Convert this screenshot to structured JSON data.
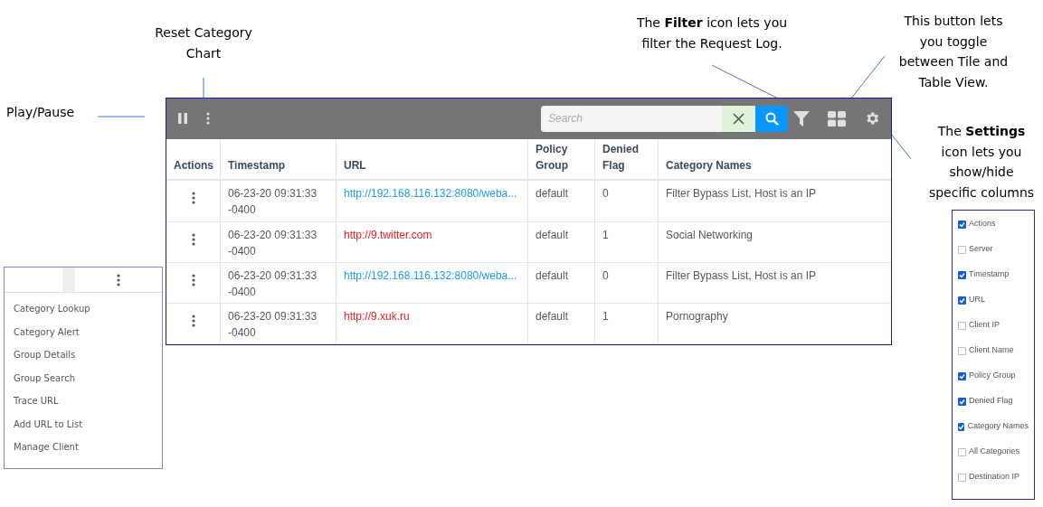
{
  "annotations": {
    "reset": "Reset Category Chart",
    "play_pause": "Play/Pause",
    "filter": "The **Filter** icon lets you filter the Request Log.",
    "toggle": "This button lets you toggle between Tile and Table View.",
    "settings": "The **Settings** icon lets you show/hide specific columns"
  },
  "toolbar": {
    "search_placeholder": "Search"
  },
  "table": {
    "columns": [
      "Actions",
      "Timestamp",
      "URL",
      "Policy Group",
      "Denied Flag",
      "Category Names"
    ],
    "rows": [
      {
        "timestamp": "06-23-20 09:31:33 -0400",
        "url": "http://192.168.116.132:8080/weba...",
        "color": "#1a9af0",
        "policy_group": "default",
        "denied_flag": "0",
        "category_names": "Filter Bypass List, Host is an IP"
      },
      {
        "timestamp": "06-23-20 09:31:33 -0400",
        "url": "http://9.twitter.com",
        "color": "#f02020",
        "policy_group": "default",
        "denied_flag": "1",
        "category_names": "Social Networking"
      },
      {
        "timestamp": "06-23-20 09:31:33 -0400",
        "url": "http://192.168.116.132:8080/weba...",
        "color": "#1a9af0",
        "policy_group": "default",
        "denied_flag": "0",
        "category_names": "Filter Bypass List, Host is an IP"
      },
      {
        "timestamp": "06-23-20 09:31:33 -0400",
        "url": "http://9.xuk.ru",
        "color": "#f02020",
        "policy_group": "default",
        "denied_flag": "1",
        "category_names": "Pornography"
      }
    ]
  },
  "actions_menu": [
    "Category Lookup",
    "Category Alert",
    "Group Details",
    "Group Search",
    "Trace URL",
    "Add URL to List",
    "Manage Client"
  ],
  "columns_panel": [
    {
      "label": "Actions",
      "checked": true
    },
    {
      "label": "Server",
      "checked": false
    },
    {
      "label": "Timestamp",
      "checked": true
    },
    {
      "label": "URL",
      "checked": true
    },
    {
      "label": "Client IP",
      "checked": false
    },
    {
      "label": "Client Name",
      "checked": false
    },
    {
      "label": "Policy Group",
      "checked": true
    },
    {
      "label": "Denied Flag",
      "checked": true
    },
    {
      "label": "Category Names",
      "checked": true
    },
    {
      "label": "All Categories",
      "checked": false
    },
    {
      "label": "Destination IP",
      "checked": false
    }
  ]
}
